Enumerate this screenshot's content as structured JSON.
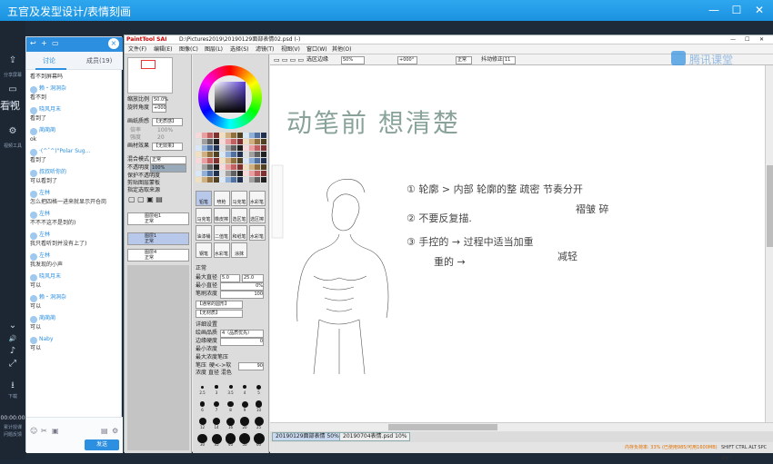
{
  "window": {
    "title": "五官及发型设计/表情刻画",
    "min": "—",
    "max": "☐",
    "close": "✕"
  },
  "rail": {
    "items": [
      {
        "icon": "share-icon",
        "glyph": "⇪",
        "label": "分享屏幕"
      },
      {
        "icon": "video-icon",
        "glyph": "▭",
        "label": "视频"
      },
      {
        "icon": "tools-icon",
        "glyph": "⚙",
        "label": "视频工具"
      }
    ],
    "bottom": [
      {
        "icon": "chevron-down-icon",
        "glyph": "⌄"
      },
      {
        "icon": "speaker-icon",
        "glyph": "🔊"
      },
      {
        "icon": "music-icon",
        "glyph": "♪"
      },
      {
        "icon": "fullscreen-icon",
        "glyph": "⤢"
      },
      {
        "icon": "download-icon",
        "glyph": "⭳"
      }
    ],
    "download_label": "下载",
    "timer": "00:00:00",
    "timer_sub": "累计授课",
    "timer_sub2": "问题反馈"
  },
  "side_text": "看视",
  "chat": {
    "tabs": [
      "讨论",
      "成员(19)"
    ],
    "messages": [
      {
        "user": "",
        "text": "看不到屏幕吗"
      },
      {
        "user": "赖・洞洞杂",
        "text": "看不到"
      },
      {
        "user": "晓风月末",
        "text": "看到了"
      },
      {
        "user": "蔺蔺蔺",
        "text": "ok"
      },
      {
        "user": "·(^ˇ^)\"Polar Sug...",
        "text": "看到了"
      },
      {
        "user": "叔叔听你的",
        "text": "可以看到了"
      },
      {
        "user": "左林",
        "text": "怎么把四格一进来就显示开仓岗"
      },
      {
        "user": "左林",
        "text": "不不不这不是到的)"
      },
      {
        "user": "左林",
        "text": "我只看听到并没有上了)"
      },
      {
        "user": "左林",
        "text": "我发现的小声"
      },
      {
        "user": "晓风月末",
        "text": "可以"
      },
      {
        "user": "赖・洞洞杂",
        "text": "可以"
      },
      {
        "user": "蔺蔺蔺",
        "text": "可以"
      },
      {
        "user": "Naby",
        "text": "可以"
      }
    ],
    "send_label": "发送"
  },
  "sai": {
    "logo": "PaintTool SAI",
    "path": "D:\\Pictures2019\\20190129面部表情02.psd (-)",
    "menu": [
      "文件(F)",
      "编辑(E)",
      "图像(C)",
      "图层(L)",
      "选择(S)",
      "滤镜(T)",
      "视图(V)",
      "窗口(W)",
      "其他(O)"
    ],
    "toolbar": {
      "antialias": "选区边缘",
      "zoom": "50%",
      "angle": "+000°",
      "mode": "正常",
      "stabilizer_label": "抖动修正",
      "stabilizer": "11"
    },
    "panel1": {
      "zoom_label": "缩放比例",
      "zoom": "50.0%",
      "angle_label": "旋转角度",
      "angle": "+000",
      "texture_label": "画纸质感",
      "texture": "【无质感】",
      "scale_label": "倍率",
      "scale": "100%",
      "strength_label": "强度",
      "strength": "20",
      "effect_label": "画材效果",
      "effect": "【无效果】",
      "blend_label": "混合模式",
      "blend": "正常",
      "opacity_label": "不透明度",
      "opacity": "100%",
      "check1": "保护不透明度",
      "check2": "剪贴图层蒙板",
      "check3": "指定选取来源",
      "layers": [
        {
          "name": "图层组1",
          "mode": "正常",
          "op": "100%"
        },
        {
          "name": "图层1",
          "mode": "正常",
          "op": "100%"
        },
        {
          "name": "图层4",
          "mode": "正常",
          "op": "100%"
        }
      ]
    },
    "panel2": {
      "tools": [
        "铅笔",
        "喷枪",
        "马克笔",
        "水彩笔",
        "马克笔",
        "橡皮擦",
        "选区笔",
        "选区擦",
        "油漆桶",
        "二值笔",
        "和纸笔",
        "水彩笔",
        "钢笔",
        "水彩笔",
        "涂抹"
      ],
      "mode": "正常",
      "max_size_label": "最大直径",
      "max_size": "5.0",
      "max_size2": "25.0",
      "min_size_label": "最小直径",
      "min_size": "0%",
      "density_label": "笔刷浓度",
      "density": "100",
      "shape": "【通常的圆形】",
      "texture": "【无材质】",
      "detail": "详细设置",
      "quality_label": "绘画品质",
      "quality": "4（品质优先）",
      "edge_label": "边缘硬度",
      "edge": "0",
      "min_density_label": "最小浓度",
      "min_density": "0",
      "pressure_label": "最大浓度笔压",
      "pressure": "100%",
      "pressure2_label": "笔压",
      "pressure2": "硬<->软",
      "pressure2_val": "90",
      "opts": [
        "浓度",
        "直径",
        "混色"
      ],
      "sizes": [
        "2.5",
        "3",
        "3.5",
        "4",
        "5",
        "6",
        "7",
        "8",
        "9",
        "10",
        "12",
        "14",
        "16",
        "20",
        "25",
        "30",
        "35",
        "40",
        "50",
        "60"
      ]
    },
    "canvas_text": {
      "title": "动笔前  想清楚",
      "line1": "① 轮廓 > 内部   轮廓的整  疏密 节奏分开",
      "line1b": "褶皱  碎",
      "line2": "② 不要反复描.",
      "line3": "③ 手控的 → 过程中适当加重",
      "line3b": "重的 →",
      "line3c": "减轻"
    },
    "file_tabs": [
      {
        "name": "20190129面部表情",
        "pct": "50%"
      },
      {
        "name": "20190704表情.psd",
        "pct": "10%"
      }
    ],
    "status": "内存负荷率: 33% (已使用985/可用1600MB)",
    "status_right": "SHIFT CTRL ALT SPC ANY"
  },
  "brand_watermark": "腾讯课堂",
  "colors": {
    "accent": "#2c8fe0",
    "titlebar": "#1b92e0",
    "ink": "#8aa39a"
  }
}
